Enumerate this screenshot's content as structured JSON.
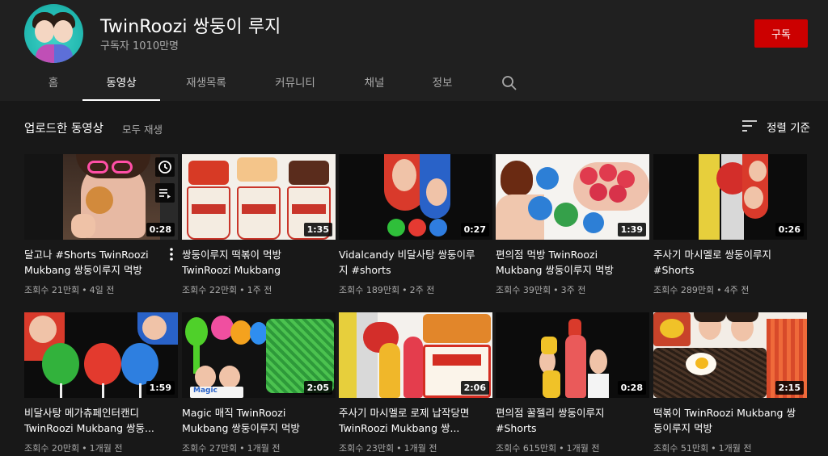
{
  "channel": {
    "name": "TwinRoozi 쌍둥이 루지",
    "subscribers": "구독자 1010만명",
    "subscribe_label": "구독"
  },
  "tabs": [
    {
      "label": "홈",
      "active": false
    },
    {
      "label": "동영상",
      "active": true
    },
    {
      "label": "재생목록",
      "active": false
    },
    {
      "label": "커뮤니티",
      "active": false
    },
    {
      "label": "채널",
      "active": false
    },
    {
      "label": "정보",
      "active": false
    }
  ],
  "section": {
    "title": "업로드한 동영상",
    "play_all": "모두 재생",
    "sort_label": "정렬 기준"
  },
  "videos": [
    {
      "title": "달고나 #Shorts TwinRoozi Mukbang 쌍둥이루지 먹방",
      "views": "조회수 21만회",
      "age": "4일 전",
      "duration": "0:28"
    },
    {
      "title": "쌍둥이루지 떡볶이 먹방 TwinRoozi Mukbang",
      "views": "조회수 22만회",
      "age": "1주 전",
      "duration": "1:35"
    },
    {
      "title": "Vidalcandy 비달사탕 쌍둥이루지 #shorts",
      "views": "조회수 189만회",
      "age": "2주 전",
      "duration": "0:27"
    },
    {
      "title": "편의점 먹방 TwinRoozi Mukbang 쌍둥이루지 먹방",
      "views": "조회수 39만회",
      "age": "3주 전",
      "duration": "1:39"
    },
    {
      "title": "주사기 마시멜로 쌍둥이루지 #Shorts",
      "views": "조회수 289만회",
      "age": "4주 전",
      "duration": "0:26"
    },
    {
      "title": "비달사탕 메가츄페인터캔디 TwinRoozi Mukbang 쌍둥...",
      "views": "조회수 20만회",
      "age": "1개월 전",
      "duration": "1:59"
    },
    {
      "title": "Magic 매직 TwinRoozi Mukbang 쌍둥이루지 먹방",
      "views": "조회수 27만회",
      "age": "1개월 전",
      "duration": "2:05"
    },
    {
      "title": "주사기 마시멜로 로제 납작당면 TwinRoozi Mukbang 쌍...",
      "views": "조회수 23만회",
      "age": "1개월 전",
      "duration": "2:06"
    },
    {
      "title": "편의점 꿀젤리 쌍둥이루지 #Shorts",
      "views": "조회수 615만회",
      "age": "1개월 전",
      "duration": "0:28"
    },
    {
      "title": "떡볶이 TwinRoozi Mukbang 쌍둥이루지 먹방",
      "views": "조회수 51만회",
      "age": "1개월 전",
      "duration": "2:15"
    }
  ],
  "thumbnail_text": {
    "magic": "Magic"
  },
  "icons": {
    "search": "search-icon",
    "sort": "sort-icon",
    "more": "more-vert-icon",
    "watch_later": "clock-icon",
    "add_queue": "playlist-add-icon"
  },
  "colors": {
    "accent": "#cc0000",
    "background": "#181818",
    "header": "#202020"
  }
}
